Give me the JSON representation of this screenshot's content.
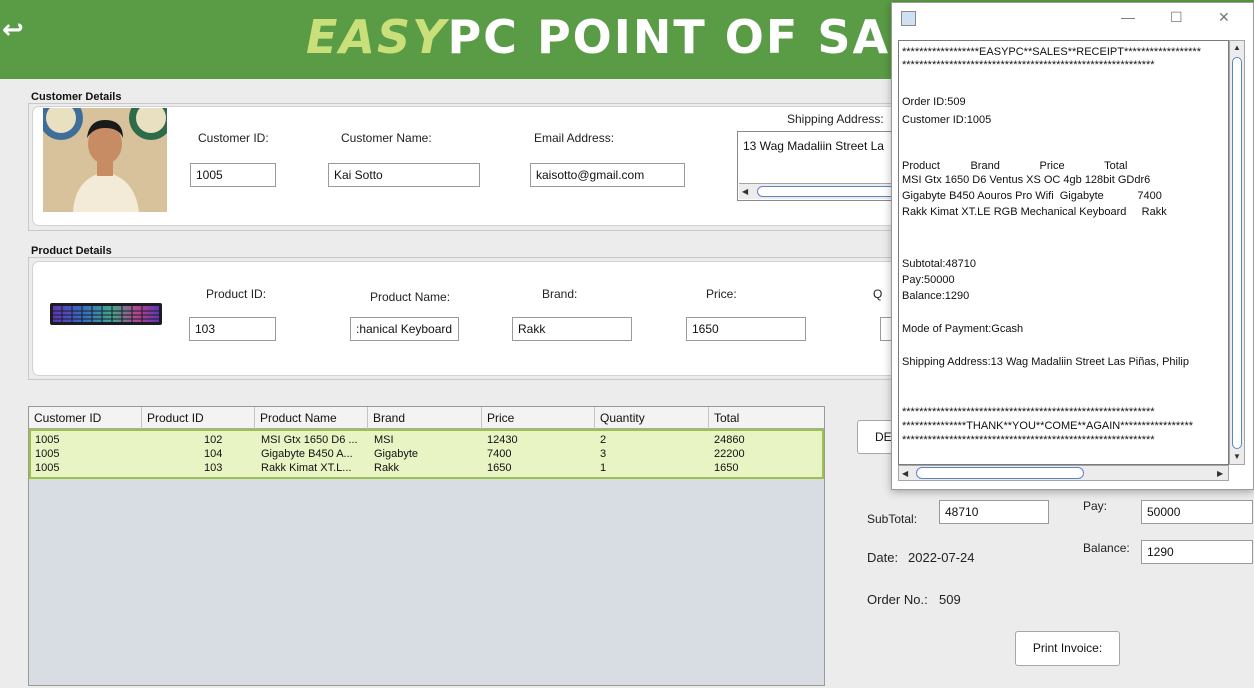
{
  "header": {
    "back_glyph": "↩",
    "title_part1": "EASY",
    "title_part2": "PC",
    "title_part3": " POINT OF SALES"
  },
  "customer": {
    "group_label": "Customer Details",
    "id_label": "Customer ID:",
    "id_value": "1005",
    "name_label": "Customer Name:",
    "name_value": "Kai Sotto",
    "email_label": "Email Address:",
    "email_value": "kaisotto@gmail.com",
    "shipping_label": "Shipping Address:",
    "shipping_value": "13 Wag Madaliin Street  La"
  },
  "product": {
    "group_label": "Product Details",
    "id_label": "Product ID:",
    "id_value": "103",
    "name_label": "Product Name:",
    "name_value": ":hanical Keyboard",
    "brand_label": "Brand:",
    "brand_value": "Rakk",
    "price_label": "Price:",
    "price_value": "1650",
    "qty_label_partial": "Q"
  },
  "table": {
    "columns": [
      "Customer ID",
      "Product ID",
      "Product Name",
      "Brand",
      "Price",
      "Quantity",
      "Total"
    ],
    "rows": [
      {
        "customer_id": "1005",
        "product_id": "102",
        "product_name": "MSI Gtx 1650 D6 ...",
        "brand": "MSI",
        "price": "12430",
        "quantity": "2",
        "total": "24860"
      },
      {
        "customer_id": "1005",
        "product_id": "104",
        "product_name": "Gigabyte B450 A...",
        "brand": "Gigabyte",
        "price": "7400",
        "quantity": "3",
        "total": "22200"
      },
      {
        "customer_id": "1005",
        "product_id": "103",
        "product_name": "Rakk Kimat XT.L...",
        "brand": "Rakk",
        "price": "1650",
        "quantity": "1",
        "total": "1650"
      }
    ]
  },
  "summary": {
    "delete_button_partial": "DE",
    "subtotal_label": "SubTotal:",
    "subtotal_value": "48710",
    "pay_label": "Pay:",
    "pay_value": "50000",
    "date_label": "Date:",
    "date_value": "2022-07-24",
    "balance_label": "Balance:",
    "balance_value": "1290",
    "order_label": "Order No.:",
    "order_value": "509",
    "print_button": "Print Invoice:"
  },
  "receipt_window": {
    "minimize": "—",
    "maximize": "☐",
    "close": "✕",
    "lines": [
      "******************EASYPC**SALES**RECEIPT******************",
      "***********************************************************",
      "",
      "Order ID:509",
      "Customer ID:1005",
      "",
      "",
      "Product          Brand             Price             Total",
      "MSI Gtx 1650 D6 Ventus XS OC 4gb 128bit GDdr6",
      "Gigabyte B450 Aouros Pro Wifi  Gigabyte           7400",
      "Rakk Kimat XT.LE RGB Mechanical Keyboard     Rakk",
      "",
      "",
      "Subtotal:48710",
      "Pay:50000",
      "Balance:1290",
      "",
      "Mode of Payment:Gcash",
      "",
      "Shipping Address:13 Wag Madaliin Street  Las Piñas, Philip",
      "",
      "",
      "***********************************************************",
      "***************THANK**YOU**COME**AGAIN*****************",
      "***********************************************************"
    ]
  }
}
